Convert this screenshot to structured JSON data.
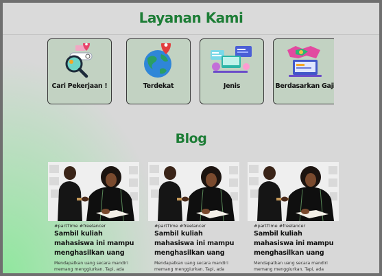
{
  "services": {
    "title": "Layanan Kami",
    "items": [
      {
        "label": "Cari Pekerjaan !",
        "icon": "job-search-icon"
      },
      {
        "label": "Terdekat",
        "icon": "globe-location-icon"
      },
      {
        "label": "Jenis",
        "icon": "workspace-icon"
      },
      {
        "label": "Berdasarkan Gaji",
        "icon": "salary-icon"
      }
    ]
  },
  "blog": {
    "title": "Blog",
    "posts": [
      {
        "tags": "#partTime #freelancer",
        "title": "Sambil  kuliah mahasiswa ini mampu menghasilkan uang",
        "desc": "Mendapatkan uang secara mandiri memang menggiurkan. Tapi, ada"
      },
      {
        "tags": "#partTime #freelancer",
        "title": "Sambil  kuliah mahasiswa ini mampu menghasilkan uang",
        "desc": "Mendapatkan uang secara mandiri memang menggiurkan. Tapi, ada"
      },
      {
        "tags": "#partTime #freelancer",
        "title": "Sambil  kuliah mahasiswa ini mampu menghasilkan uang",
        "desc": "Mendapatkan uang secara mandiri memang menggiurkan. Tapi, ada"
      }
    ]
  },
  "colors": {
    "accent": "#1d7d36",
    "card": "#c2d2c2",
    "background": "#d8d8d8"
  }
}
